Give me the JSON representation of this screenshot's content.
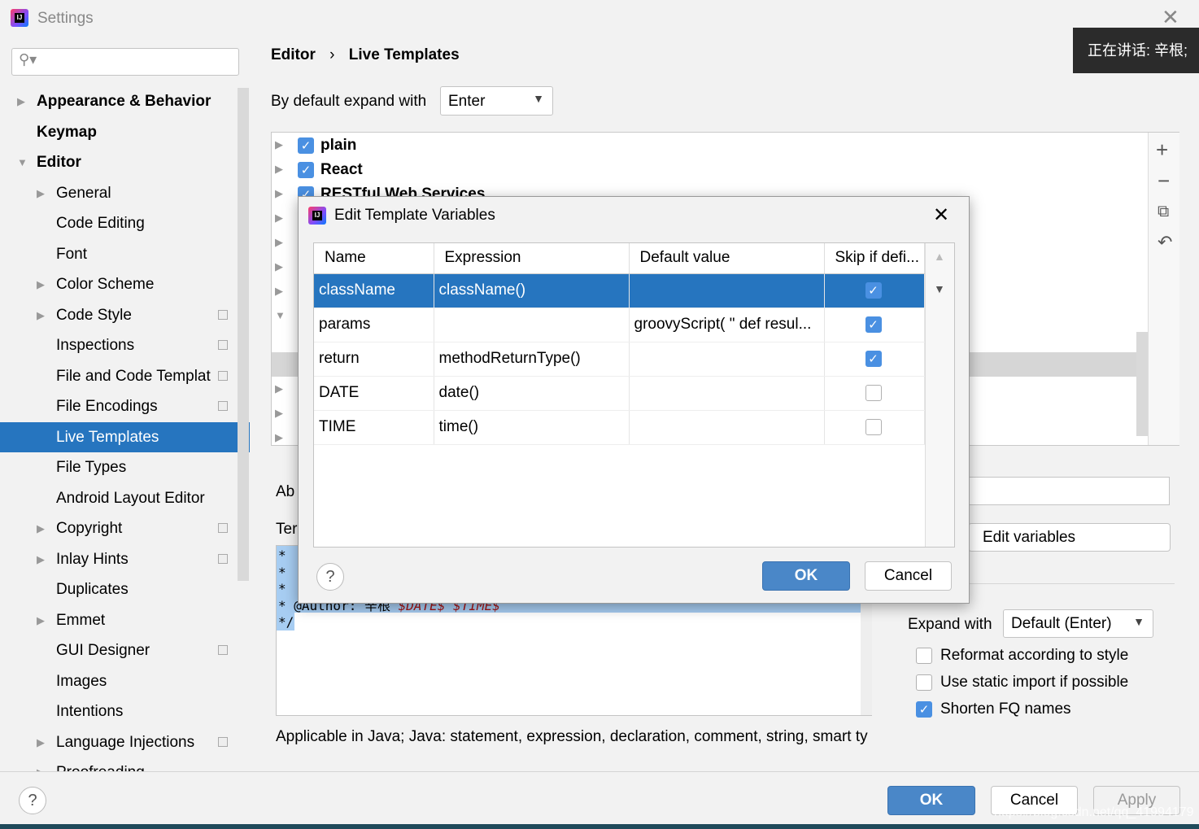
{
  "window": {
    "title": "Settings",
    "speaking": "正在讲话: 辛根;"
  },
  "sidebar": {
    "items": [
      {
        "label": "Appearance & Behavior",
        "level": 0,
        "expand": "collapsed",
        "bold": true
      },
      {
        "label": "Keymap",
        "level": 0,
        "expand": "none",
        "bold": true
      },
      {
        "label": "Editor",
        "level": 0,
        "expand": "expanded",
        "bold": true
      },
      {
        "label": "General",
        "level": 1,
        "expand": "collapsed"
      },
      {
        "label": "Code Editing",
        "level": 1,
        "expand": "none"
      },
      {
        "label": "Font",
        "level": 1,
        "expand": "none"
      },
      {
        "label": "Color Scheme",
        "level": 1,
        "expand": "collapsed"
      },
      {
        "label": "Code Style",
        "level": 1,
        "expand": "collapsed",
        "copy": true
      },
      {
        "label": "Inspections",
        "level": 1,
        "expand": "none",
        "copy": true
      },
      {
        "label": "File and Code Templat",
        "level": 1,
        "expand": "none",
        "copy": true
      },
      {
        "label": "File Encodings",
        "level": 1,
        "expand": "none",
        "copy": true
      },
      {
        "label": "Live Templates",
        "level": 1,
        "expand": "none",
        "selected": true
      },
      {
        "label": "File Types",
        "level": 1,
        "expand": "none"
      },
      {
        "label": "Android Layout Editor",
        "level": 1,
        "expand": "none"
      },
      {
        "label": "Copyright",
        "level": 1,
        "expand": "collapsed",
        "copy": true
      },
      {
        "label": "Inlay Hints",
        "level": 1,
        "expand": "collapsed",
        "copy": true
      },
      {
        "label": "Duplicates",
        "level": 1,
        "expand": "none"
      },
      {
        "label": "Emmet",
        "level": 1,
        "expand": "collapsed"
      },
      {
        "label": "GUI Designer",
        "level": 1,
        "expand": "none",
        "copy": true
      },
      {
        "label": "Images",
        "level": 1,
        "expand": "none"
      },
      {
        "label": "Intentions",
        "level": 1,
        "expand": "none"
      },
      {
        "label": "Language Injections",
        "level": 1,
        "expand": "collapsed",
        "copy": true
      },
      {
        "label": "Proofreading",
        "level": 1,
        "expand": "collapsed"
      }
    ]
  },
  "breadcrumb": {
    "parent": "Editor",
    "current": "Live Templates"
  },
  "expand_default": {
    "label": "By default expand with",
    "value": "Enter"
  },
  "template_groups": [
    {
      "label": "plain",
      "checked": true
    },
    {
      "label": "React",
      "checked": true
    },
    {
      "label": "RESTful Web Services",
      "checked": true
    }
  ],
  "labels": {
    "abbrev": "Ab",
    "template_text": "Ter",
    "edit_variables": "Edit variables",
    "expand_with": "Expand with",
    "expand_with_value": "Default (Enter)",
    "applicable": "Applicable in Java; Java: statement, expression, declaration, comment, string, smart ty"
  },
  "code": {
    "lines": [
      " *",
      " *",
      " *"
    ],
    "author_line": " * @Author: 辛根 ",
    "date_var": "$DATE$",
    "time_var": "$TIME$",
    "end": "*/"
  },
  "options": [
    {
      "label": "Reformat according to style",
      "checked": false
    },
    {
      "label": "Use static import if possible",
      "checked": false
    },
    {
      "label": "Shorten FQ names",
      "checked": true
    }
  ],
  "dialog": {
    "title": "Edit Template Variables",
    "columns": [
      "Name",
      "Expression",
      "Default value",
      "Skip if defi..."
    ],
    "rows": [
      {
        "name": "className",
        "expression": "className()",
        "default": "",
        "skip": true,
        "selected": true
      },
      {
        "name": "params",
        "expression": "",
        "default": "groovyScript( \" def resul...",
        "skip": true
      },
      {
        "name": "return",
        "expression": "methodReturnType()",
        "default": "",
        "skip": true
      },
      {
        "name": "DATE",
        "expression": "date()",
        "default": "",
        "skip": false
      },
      {
        "name": "TIME",
        "expression": "time()",
        "default": "",
        "skip": false
      }
    ],
    "ok": "OK",
    "cancel": "Cancel"
  },
  "footer": {
    "ok": "OK",
    "cancel": "Cancel",
    "apply": "Apply",
    "watermark": "https://blog.csdn.net/qq_41994179"
  },
  "colors": {
    "accent": "#2675bf",
    "primary_button": "#4a87c8",
    "variable": "#a31515"
  }
}
